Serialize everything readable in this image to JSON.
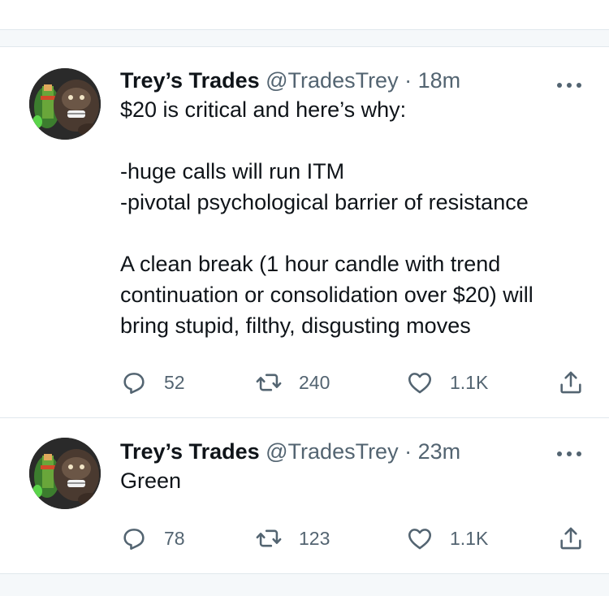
{
  "tweets": [
    {
      "display_name": "Trey’s Trades",
      "handle": "@TradesTrey",
      "separator": "·",
      "time": "18m",
      "lines": [
        "$20 is critical and here’s why:",
        "",
        "-huge calls will run ITM",
        "-pivotal psychological barrier of resistance",
        "",
        "A clean break (1 hour candle with trend",
        "continuation or consolidation over $20) will",
        "bring stupid, filthy, disgusting moves"
      ],
      "replies": "52",
      "retweets": "240",
      "likes": "1.1K"
    },
    {
      "display_name": "Trey’s Trades",
      "handle": "@TradesTrey",
      "separator": "·",
      "time": "23m",
      "lines": [
        "Green"
      ],
      "replies": "78",
      "retweets": "123",
      "likes": "1.1K"
    }
  ],
  "icons": {
    "avatar": "gorilla-avatar",
    "more": "more-dots-icon",
    "reply": "reply-icon",
    "retweet": "retweet-icon",
    "like": "heart-icon",
    "share": "share-icon"
  },
  "colors": {
    "text": "#0f1419",
    "secondary": "#536471",
    "divider": "#e1e8ed",
    "gap_background": "#f5f8fa"
  }
}
